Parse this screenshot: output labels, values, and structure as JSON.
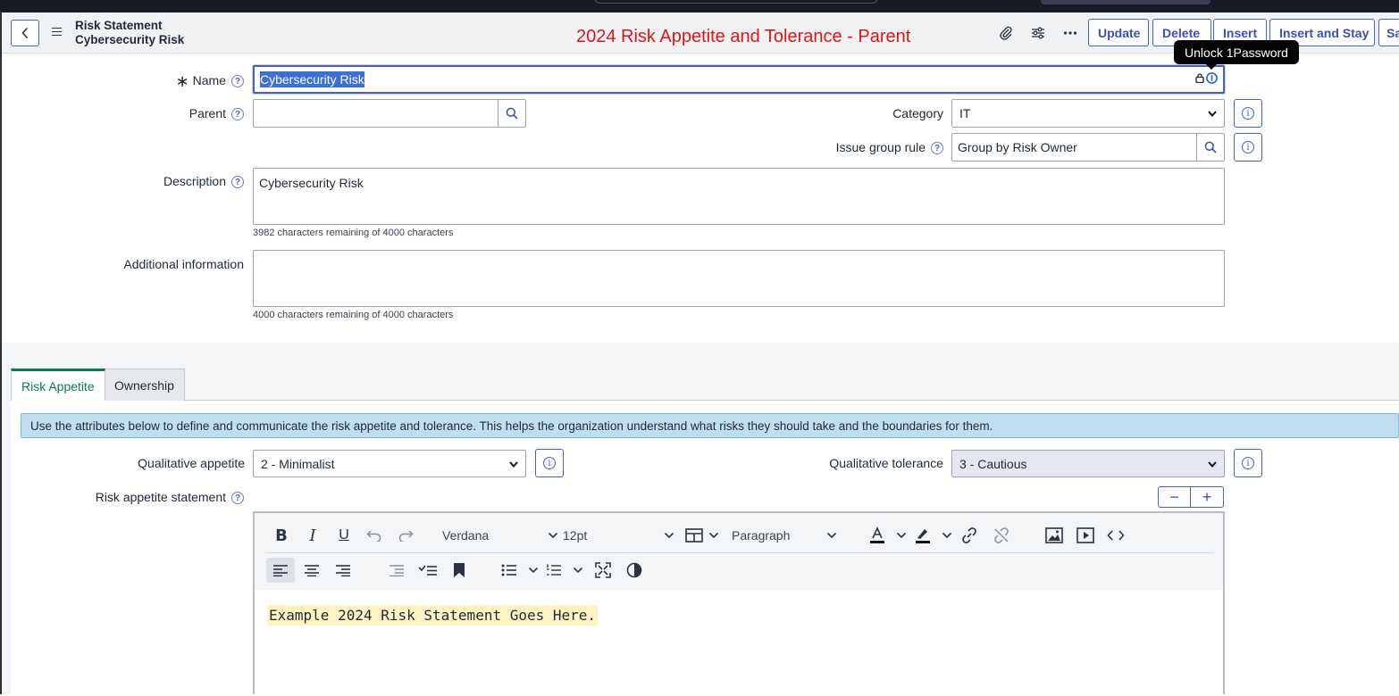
{
  "header": {
    "record_type": "Risk Statement",
    "record_name": "Cybersecurity Risk",
    "banner_text": "2024 Risk Appetite and Tolerance - Parent",
    "buttons": {
      "update": "Update",
      "delete": "Delete",
      "insert": "Insert",
      "insert_and_stay": "Insert and Stay",
      "save": "Save"
    },
    "icons": [
      "back-icon",
      "menu-icon",
      "paperclip-icon",
      "sliders-icon",
      "more-icon"
    ]
  },
  "tooltip": {
    "text": "Unlock 1Password"
  },
  "form": {
    "name": {
      "label": "Name",
      "required_mark": "∗",
      "value": "Cybersecurity Risk"
    },
    "parent": {
      "label": "Parent",
      "value": ""
    },
    "category": {
      "label": "Category",
      "value": "IT"
    },
    "issue_group_rule": {
      "label": "Issue group rule",
      "value": "Group by Risk Owner"
    },
    "description": {
      "label": "Description",
      "value": "Cybersecurity Risk",
      "counter": "3982 characters remaining of 4000 characters"
    },
    "additional_information": {
      "label": "Additional information",
      "value": "",
      "counter": "4000 characters remaining of 4000 characters"
    }
  },
  "tabs": [
    {
      "label": "Risk Appetite",
      "active": true
    },
    {
      "label": "Ownership",
      "active": false
    }
  ],
  "risk_appetite": {
    "info_message": "Use the attributes below to define and communicate the risk appetite and tolerance. This helps the organization understand what risks they should take and the boundaries for them.",
    "qualitative_appetite": {
      "label": "Qualitative appetite",
      "value": "2 - Minimalist"
    },
    "qualitative_tolerance": {
      "label": "Qualitative tolerance",
      "value": "3 - Cautious"
    },
    "statement": {
      "label": "Risk appetite statement",
      "minus": "−",
      "plus": "+",
      "toolbar": {
        "font": "Verdana",
        "size": "12pt",
        "block": "Paragraph"
      },
      "content": "Example 2024 Risk Statement Goes Here."
    }
  },
  "colors": {
    "accent": "#4a5ec8",
    "banner": "#e0141a",
    "tab_active": "#0b7a56",
    "info_bg": "#bfdff0",
    "highlight": "#fff3c4"
  }
}
